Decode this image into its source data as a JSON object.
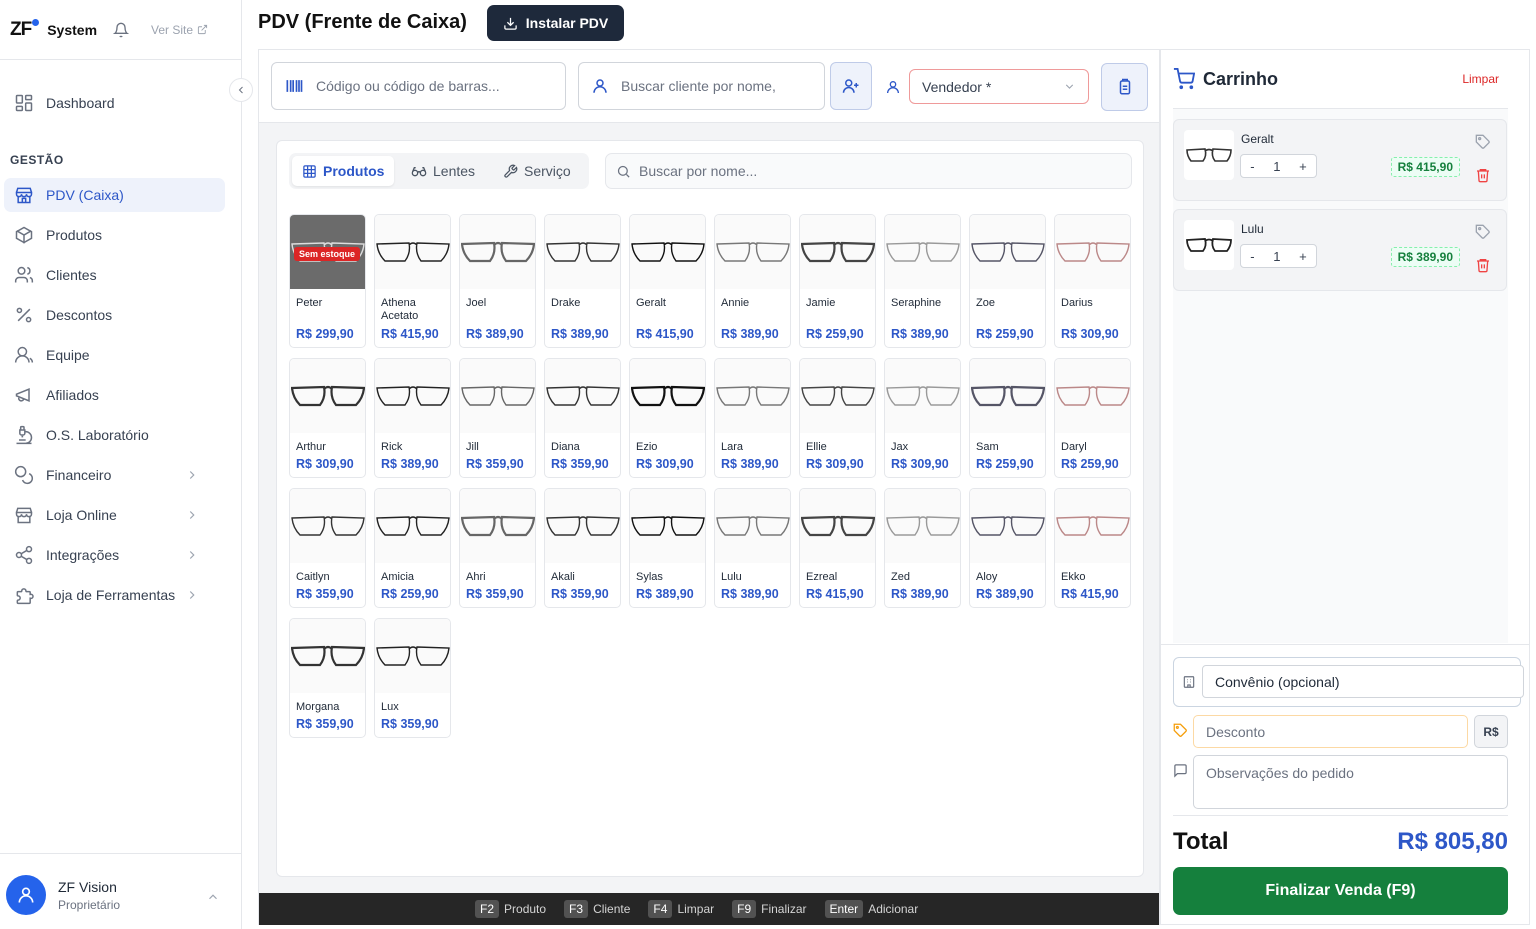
{
  "app": {
    "brand": "ZF",
    "system": "System",
    "ver_site": "Ver Site"
  },
  "sidebar": {
    "section": "GESTÃO",
    "items": [
      {
        "label": "Dashboard",
        "icon": "dashboard-icon"
      },
      {
        "label": "PDV (Caixa)",
        "icon": "store-icon",
        "active": true
      },
      {
        "label": "Produtos",
        "icon": "box-icon"
      },
      {
        "label": "Clientes",
        "icon": "users-icon"
      },
      {
        "label": "Descontos",
        "icon": "percent-icon"
      },
      {
        "label": "Equipe",
        "icon": "team-icon"
      },
      {
        "label": "Afiliados",
        "icon": "megaphone-icon"
      },
      {
        "label": "O.S. Laboratório",
        "icon": "microscope-icon"
      },
      {
        "label": "Financeiro",
        "icon": "coins-icon",
        "expandable": true
      },
      {
        "label": "Loja Online",
        "icon": "shop-icon",
        "expandable": true
      },
      {
        "label": "Integrações",
        "icon": "share-icon",
        "expandable": true
      },
      {
        "label": "Loja de Ferramentas",
        "icon": "puzzle-icon",
        "expandable": true
      }
    ],
    "user": {
      "name": "ZF Vision",
      "role": "Proprietário"
    }
  },
  "header": {
    "title": "PDV (Frente de Caixa)",
    "install_label": "Instalar PDV"
  },
  "toolbar": {
    "barcode_placeholder": "Código ou código de barras...",
    "client_placeholder": "Buscar cliente por nome,",
    "vendor_label": "Vendedor *"
  },
  "tabs": [
    {
      "label": "Produtos",
      "active": true
    },
    {
      "label": "Lentes"
    },
    {
      "label": "Serviço"
    }
  ],
  "product_search_placeholder": "Buscar por nome...",
  "out_of_stock_label": "Sem estoque",
  "products": [
    {
      "name": "Peter",
      "price": "R$ 299,90",
      "out_of_stock": true
    },
    {
      "name": "Athena Acetato",
      "price": "R$ 415,90"
    },
    {
      "name": "Joel",
      "price": "R$ 389,90"
    },
    {
      "name": "Drake",
      "price": "R$ 389,90"
    },
    {
      "name": "Geralt",
      "price": "R$ 415,90"
    },
    {
      "name": "Annie",
      "price": "R$ 389,90"
    },
    {
      "name": "Jamie",
      "price": "R$ 259,90"
    },
    {
      "name": "Seraphine",
      "price": "R$ 389,90"
    },
    {
      "name": "Zoe",
      "price": "R$ 259,90"
    },
    {
      "name": "Darius",
      "price": "R$ 309,90"
    },
    {
      "name": "Arthur",
      "price": "R$ 309,90"
    },
    {
      "name": "Rick",
      "price": "R$ 389,90"
    },
    {
      "name": "Jill",
      "price": "R$ 359,90"
    },
    {
      "name": "Diana",
      "price": "R$ 359,90"
    },
    {
      "name": "Ezio",
      "price": "R$ 309,90"
    },
    {
      "name": "Lara",
      "price": "R$ 389,90"
    },
    {
      "name": "Ellie",
      "price": "R$ 309,90"
    },
    {
      "name": "Jax",
      "price": "R$ 309,90"
    },
    {
      "name": "Sam",
      "price": "R$ 259,90"
    },
    {
      "name": "Daryl",
      "price": "R$ 259,90"
    },
    {
      "name": "Caitlyn",
      "price": "R$ 359,90"
    },
    {
      "name": "Amicia",
      "price": "R$ 259,90"
    },
    {
      "name": "Ahri",
      "price": "R$ 359,90"
    },
    {
      "name": "Akali",
      "price": "R$ 359,90"
    },
    {
      "name": "Sylas",
      "price": "R$ 389,90"
    },
    {
      "name": "Lulu",
      "price": "R$ 389,90"
    },
    {
      "name": "Ezreal",
      "price": "R$ 415,90"
    },
    {
      "name": "Zed",
      "price": "R$ 389,90"
    },
    {
      "name": "Aloy",
      "price": "R$ 389,90"
    },
    {
      "name": "Ekko",
      "price": "R$ 415,90"
    },
    {
      "name": "Morgana",
      "price": "R$ 359,90"
    },
    {
      "name": "Lux",
      "price": "R$ 359,90"
    }
  ],
  "shortcuts": [
    {
      "key": "F2",
      "label": "Produto"
    },
    {
      "key": "F3",
      "label": "Cliente"
    },
    {
      "key": "F4",
      "label": "Limpar"
    },
    {
      "key": "F9",
      "label": "Finalizar"
    },
    {
      "key": "Enter",
      "label": "Adicionar"
    }
  ],
  "cart": {
    "title": "Carrinho",
    "clear_label": "Limpar",
    "items": [
      {
        "name": "Geralt",
        "qty": "1",
        "price": "R$ 415,90"
      },
      {
        "name": "Lulu",
        "qty": "1",
        "price": "R$ 389,90"
      }
    ],
    "convenio_placeholder": "Convênio (opcional)",
    "discount_placeholder": "Desconto",
    "discount_unit": "R$",
    "notes_placeholder": "Observações do pedido",
    "total_label": "Total",
    "total_value": "R$ 805,80",
    "finish_label": "Finalizar Venda  (F9)"
  },
  "colors": {
    "accent": "#2d57c8",
    "success": "#15803d",
    "danger": "#dc2626",
    "dark": "#1e293b"
  }
}
